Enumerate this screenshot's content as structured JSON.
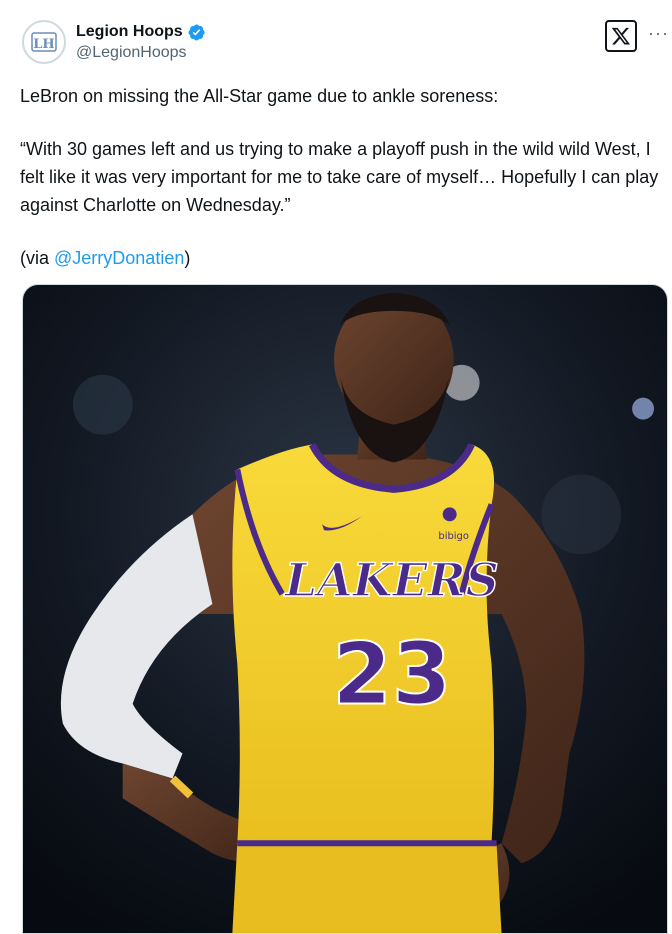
{
  "author": {
    "display_name": "Legion Hoops",
    "handle": "@LegionHoops",
    "avatar_icon": "legion-hoops-logo",
    "verified_icon": "verified-badge-icon",
    "verified_color": "#1d9bf0"
  },
  "actions": {
    "x_icon": "x-logo-icon",
    "more_label": "···"
  },
  "post": {
    "line1": "LeBron on missing the All-Star game due to ankle soreness:",
    "quote": "“With 30 games left and us trying to make a playoff push in the wild wild West, I felt like it was very important for me to take care of myself… Hopefully I can play against Charlotte on Wednesday.”",
    "via_prefix": "(via ",
    "via_link": "@JerryDonatien",
    "via_suffix": ")",
    "link_color": "#1d9bf0"
  },
  "media": {
    "jersey_brand": "LAKERS",
    "jersey_number": "23",
    "sponsor": "bibigo",
    "jersey_color": "#f6d32d",
    "trim_color": "#4b2a8a"
  }
}
